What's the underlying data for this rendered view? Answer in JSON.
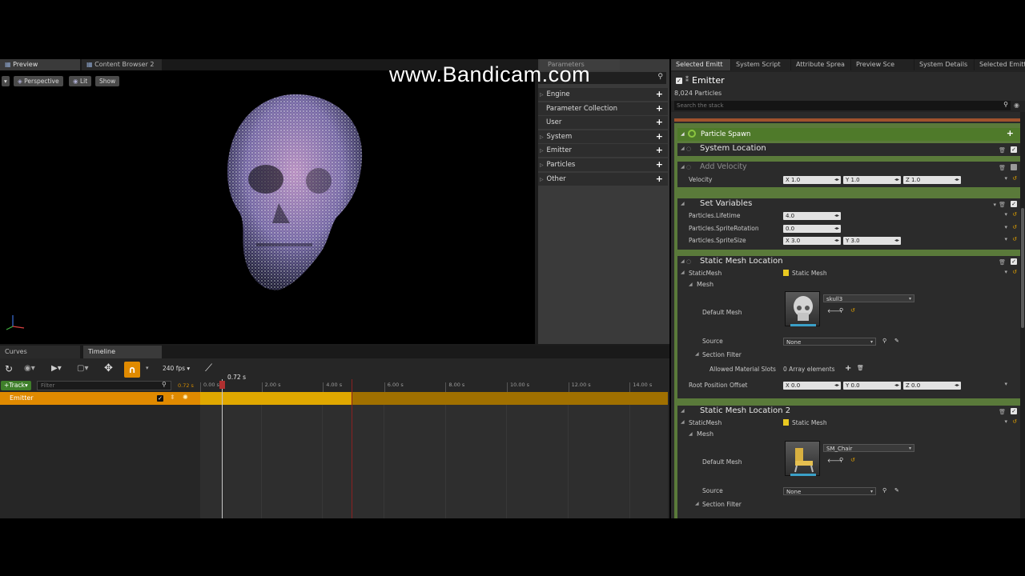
{
  "watermark": "www.Bandicam.com",
  "left_tabs": {
    "preview": "Preview",
    "content_browser": "Content Browser 2"
  },
  "viewport": {
    "perspective": "Perspective",
    "lit": "Lit",
    "show": "Show"
  },
  "parameters": {
    "tab": "Parameters",
    "rows": [
      "Engine",
      "Parameter Collection",
      "User",
      "System",
      "Emitter",
      "Particles",
      "Other"
    ]
  },
  "timeline": {
    "tabs": {
      "curves": "Curves",
      "timeline": "Timeline"
    },
    "fps": "240 fps",
    "current_time": "0.72 s",
    "current_time_small": "0.72 s",
    "track_button": "Track",
    "filter_placeholder": "Filter",
    "emitter_row": "Emitter",
    "ticks": [
      "0.00 s",
      "2.00 s",
      "4.00 s",
      "6.00 s",
      "8.00 s",
      "10.00 s",
      "12.00 s",
      "14.00 s"
    ]
  },
  "right_tabs": [
    "Selected Emitt",
    "System Script",
    "Attribute Sprea",
    "Preview Sce",
    "System Details",
    "Selected Emitt"
  ],
  "emitter": {
    "title": "Emitter",
    "count": "8,024 Particles",
    "search_placeholder": "Search the stack"
  },
  "modules": {
    "particle_spawn": "Particle Spawn",
    "system_location": "System Location",
    "add_velocity": {
      "title": "Add Velocity",
      "label": "Velocity",
      "x": "X 1.0",
      "y": "Y 1.0",
      "z": "Z 1.0"
    },
    "set_variables": {
      "title": "Set Variables",
      "lifetime_label": "Particles.Lifetime",
      "lifetime": "4.0",
      "rotation_label": "Particles.SpriteRotation",
      "rotation": "0.0",
      "size_label": "Particles.SpriteSize",
      "size_x": "X 3.0",
      "size_y": "Y 3.0"
    },
    "sml1": {
      "title": "Static Mesh Location",
      "static_mesh_label": "StaticMesh",
      "static_mesh_value": "Static Mesh",
      "mesh_label": "Mesh",
      "default_mesh_label": "Default Mesh",
      "default_mesh_value": "skull3",
      "source_label": "Source",
      "source_value": "None",
      "section_filter": "Section Filter",
      "allowed_label": "Allowed Material Slots",
      "allowed_value": "0 Array elements",
      "root_label": "Root Position Offset",
      "root_x": "X 0.0",
      "root_y": "Y 0.0",
      "root_z": "Z 0.0"
    },
    "sml2": {
      "title": "Static Mesh Location 2",
      "static_mesh_label": "StaticMesh",
      "static_mesh_value": "Static Mesh",
      "mesh_label": "Mesh",
      "default_mesh_label": "Default Mesh",
      "default_mesh_value": "SM_Chair",
      "source_label": "Source",
      "source_value": "None",
      "section_filter": "Section Filter"
    }
  },
  "colors": {
    "spawn_green": "#8cc63f",
    "track_orange": "#d9a000",
    "emitter_row_orange": "#e08a00",
    "playhead_red": "#b03030"
  }
}
